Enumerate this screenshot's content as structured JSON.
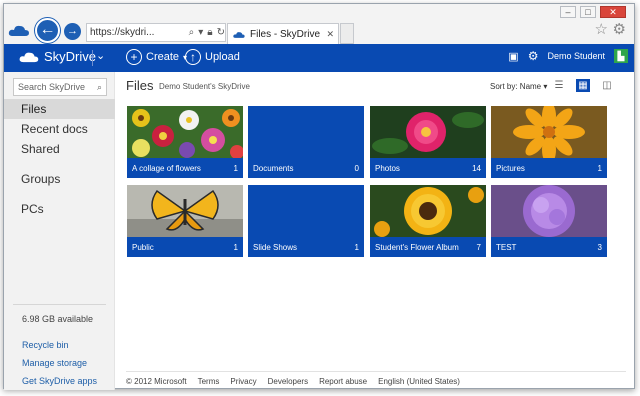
{
  "browser": {
    "url": "https://skydri...",
    "tab_title": "Files - SkyDrive",
    "window_buttons": [
      "–",
      "□",
      "✕"
    ]
  },
  "header": {
    "brand": "SkyDrive",
    "create_label": "Create",
    "upload_label": "Upload",
    "user_name": "Demo Student",
    "accent": "#094ab2"
  },
  "sidebar": {
    "search_placeholder": "Search SkyDrive",
    "items": [
      {
        "label": "Files",
        "selected": true
      },
      {
        "label": "Recent docs"
      },
      {
        "label": "Shared"
      },
      {
        "label": "Groups"
      },
      {
        "label": "PCs"
      }
    ],
    "storage_available": "6.98 GB available",
    "links": [
      "Recycle bin",
      "Manage storage",
      "Get SkyDrive apps"
    ]
  },
  "main": {
    "title": "Files",
    "breadcrumb": "Demo Student's SkyDrive",
    "sort_label": "Sort by: Name",
    "tiles": [
      {
        "name": "A collage of flowers",
        "count": "1",
        "image": "flowers-collage"
      },
      {
        "name": "Documents",
        "count": "0",
        "image": "none"
      },
      {
        "name": "Photos",
        "count": "14",
        "image": "pink-flower"
      },
      {
        "name": "Pictures",
        "count": "1",
        "image": "orange-flower"
      },
      {
        "name": "Public",
        "count": "1",
        "image": "butterfly"
      },
      {
        "name": "Slide Shows",
        "count": "1",
        "image": "none"
      },
      {
        "name": "Student's Flower Album",
        "count": "7",
        "image": "yellow-flower"
      },
      {
        "name": "TEST",
        "count": "3",
        "image": "purple-flower"
      }
    ]
  },
  "footer": {
    "links": [
      "© 2012 Microsoft",
      "Terms",
      "Privacy",
      "Developers",
      "Report abuse",
      "English (United States)"
    ]
  }
}
